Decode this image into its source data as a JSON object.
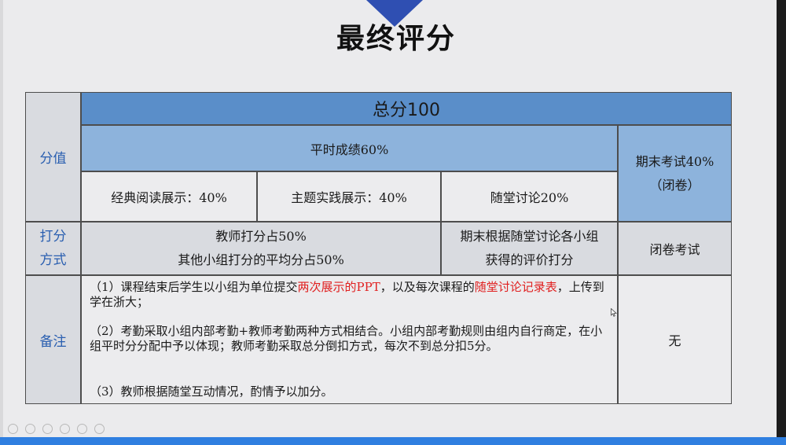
{
  "title": "最终评分",
  "table": {
    "total": "总分100",
    "row_labels": {
      "score": "分值",
      "method": "打分方式",
      "notes": "备注"
    },
    "regular": "平时成绩60%",
    "final_exam": {
      "line1": "期末考试40%",
      "line2": "（闭卷）"
    },
    "sub_items": [
      "经典阅读展示：40%",
      "主题实践展示：40%",
      "随堂讨论20%"
    ],
    "method_presentation": {
      "line1": "教师打分占50%",
      "line2": "其他小组打分的平均分占50%"
    },
    "method_discussion": {
      "line1": "期末根据随堂讨论各小组",
      "line2": "获得的评价打分"
    },
    "method_final": "闭卷考试",
    "notes": {
      "n1": {
        "a": "（1）课程结束后学生以小组为单位提交",
        "red1": "两次展示的PPT",
        "b": "，以及每次课程的",
        "red2": "随堂讨论记录表",
        "c": "，上传到学在浙大；"
      },
      "n2": "（2）考勤采取小组内部考勤+教师考勤两种方式相结合。小组内部考勤规则由组内自行商定，在小组平时分分配中予以体现；教师考勤采取总分倒扣方式，每次不到总分扣5分。",
      "n3": "（3）教师根据随堂互动情况，酌情予以加分。"
    },
    "final_notes": "无"
  },
  "colors": {
    "header_total": "#5a8ec9",
    "header_regular": "#8db3dc",
    "label_text": "#2a5fb0",
    "highlight": "#e02020",
    "bottom_bar": "#2f7fe0"
  }
}
